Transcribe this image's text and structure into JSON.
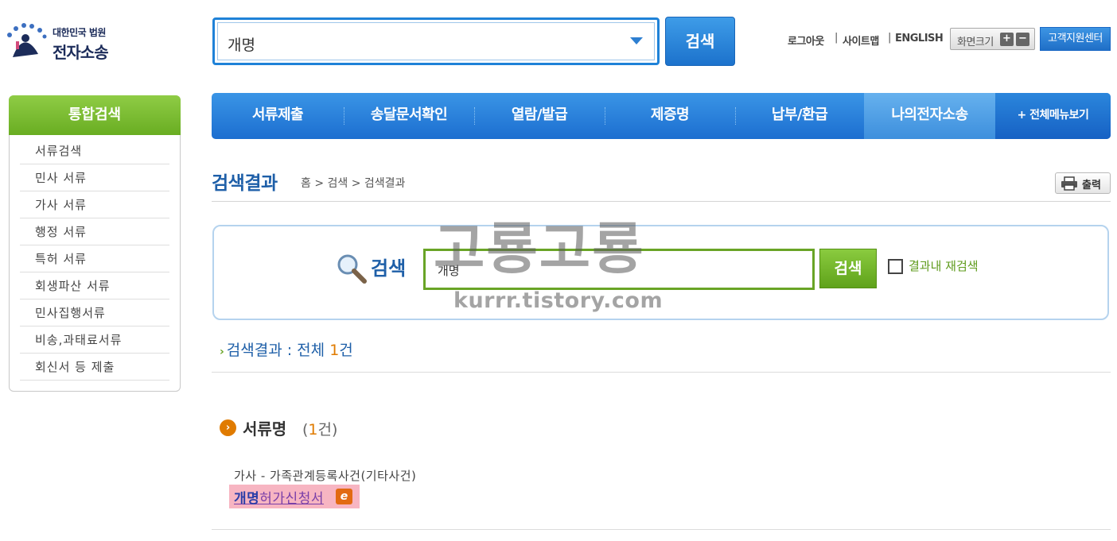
{
  "logo": {
    "sub": "대한민국 법원",
    "main": "전자소송"
  },
  "top_search": {
    "value": "개명",
    "button": "검색"
  },
  "util": {
    "logout": "로그아웃",
    "sitemap": "사이트맵",
    "english": "ENGLISH",
    "sep": "|",
    "zoom_label": "화면크기",
    "zoom_in": "+",
    "zoom_out": "−",
    "support": "고객지원센터"
  },
  "sidebar": {
    "title": "통합검색",
    "items": [
      {
        "label": "서류검색"
      },
      {
        "label": "민사 서류"
      },
      {
        "label": "가사 서류"
      },
      {
        "label": "행정 서류"
      },
      {
        "label": "특허 서류"
      },
      {
        "label": "회생파산 서류"
      },
      {
        "label": "민사집행서류"
      },
      {
        "label": "비송,과태료서류"
      },
      {
        "label": "회신서 등 제출"
      }
    ]
  },
  "gnb": {
    "items": [
      {
        "label": "서류제출"
      },
      {
        "label": "송달문서확인"
      },
      {
        "label": "열람/발급"
      },
      {
        "label": "제증명"
      },
      {
        "label": "납부/환급"
      },
      {
        "label": "나의전자소송"
      }
    ],
    "all_menu": "+ 전체메뉴보기"
  },
  "page": {
    "title": "검색결과",
    "breadcrumb": "홈 > 검색 > 검색결과",
    "print": "출력"
  },
  "search_panel": {
    "label": "검색",
    "value": "개명",
    "button": "검색",
    "research_label": "결과내 재검색"
  },
  "watermark": {
    "main": "고룡고룡",
    "url": "kurrr.tistory.com"
  },
  "results": {
    "total_prefix": "검색결과 : 전체 ",
    "total_count": "1",
    "total_suffix": "건",
    "section_title": "서류명",
    "section_count_prefix": "(",
    "section_count": "1",
    "section_count_suffix": "건)",
    "doc_path": "가사 - 가족관계등록사건(기타사건)",
    "doc_highlight": "개명",
    "doc_rest": "허가신청서",
    "doc_badge": "e"
  },
  "colors": {
    "brand_blue": "#1f82d8",
    "nav_blue": "#2b86dc",
    "sidebar_green": "#69ad22",
    "accent_orange": "#e07b00",
    "highlight_pink": "#f7b5c2"
  }
}
